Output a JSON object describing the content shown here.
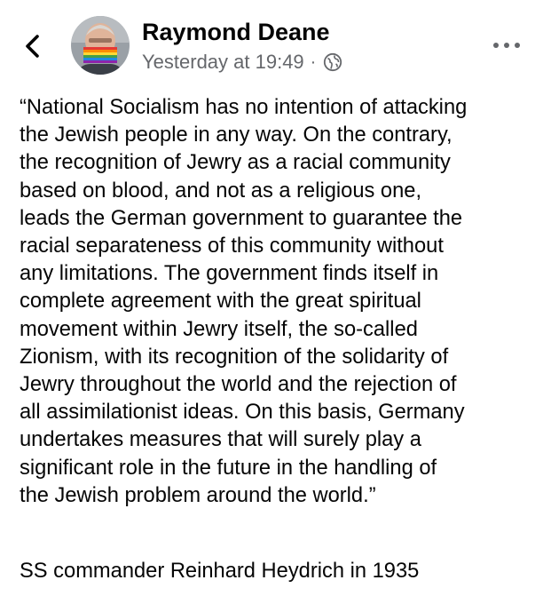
{
  "post": {
    "author_name": "Raymond Deane",
    "timestamp": "Yesterday at 19:49",
    "separator": "·",
    "audience_icon": "globe-icon",
    "back_icon": "chevron-left-icon",
    "more_icon": "more-horizontal-icon",
    "body_lines": [
      "“National Socialism has no intention of attacking",
      "the Jewish people in any way. On the contrary,",
      "the recognition of Jewry as a racial community",
      "based on blood, and not as a religious one,",
      "leads the German government to guarantee the",
      "racial separateness of this community without",
      "any limitations. The government finds itself in",
      "complete agreement with the great spiritual",
      "movement within Jewry itself, the so-called",
      "Zionism, with its recognition of the solidarity of",
      "Jewry throughout the world and the rejection of",
      "all assimilationist ideas. On this basis, Germany",
      "undertakes measures that will surely play a",
      "significant role in the future in the handling of",
      "the Jewish problem around the world.”"
    ],
    "attribution": "SS commander Reinhard Heydrich in 1935"
  },
  "colors": {
    "text_primary": "#050505",
    "text_secondary": "#65676b",
    "background": "#ffffff"
  }
}
